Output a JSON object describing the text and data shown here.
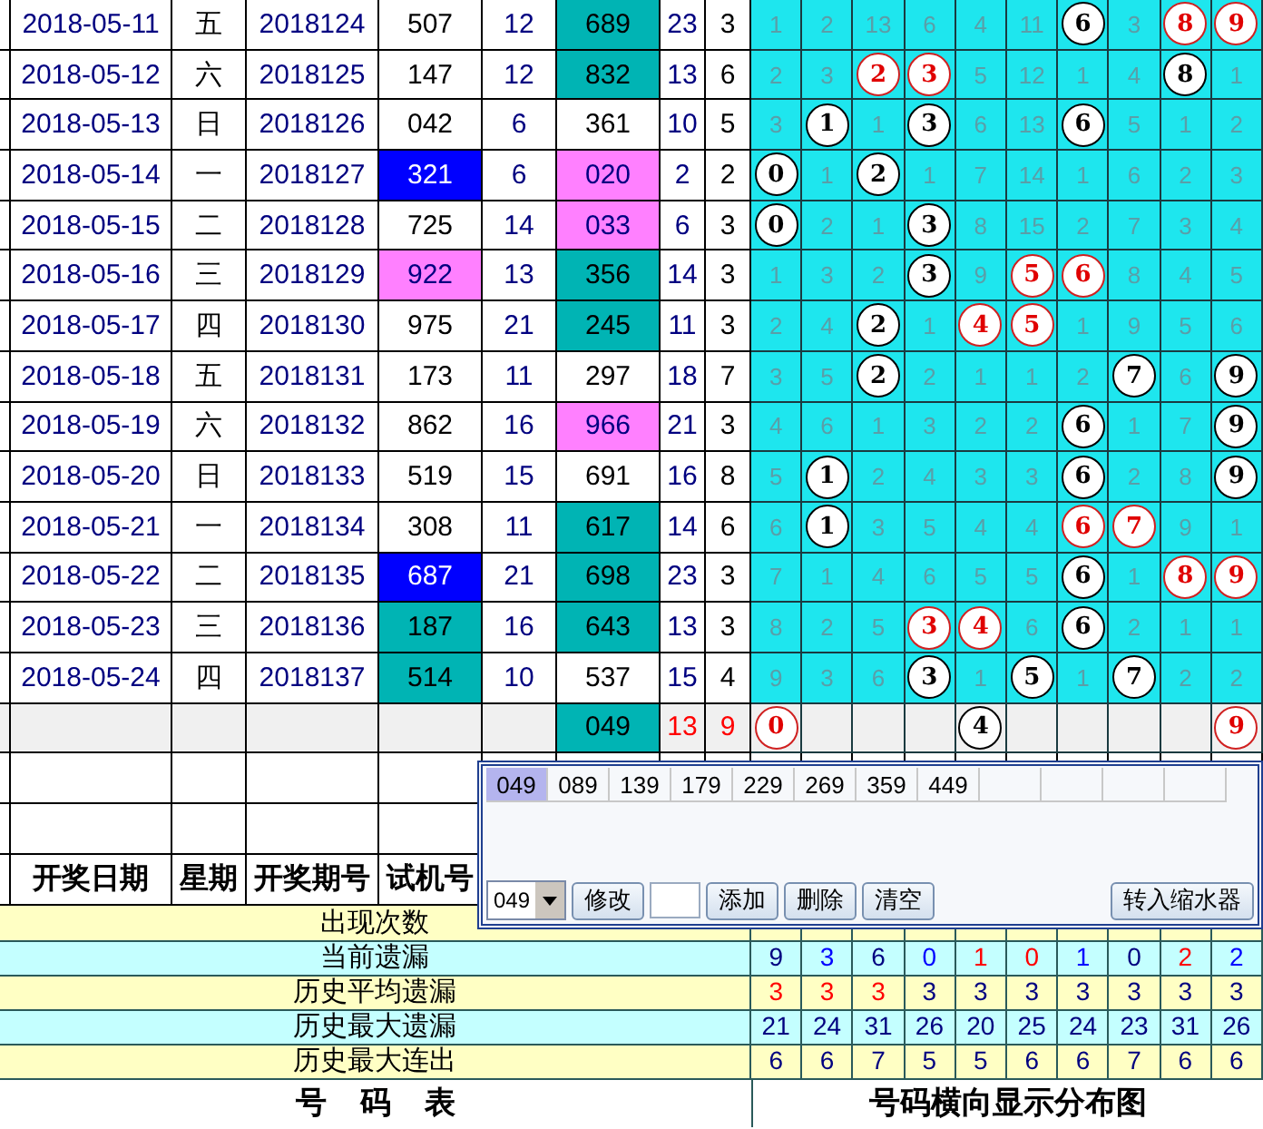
{
  "rows": [
    {
      "date": "2018-05-11",
      "weekday": "五",
      "period": "2018124",
      "trial": {
        "value": "507"
      },
      "sum": "12",
      "result": {
        "value": "689",
        "color": "#00b4b4"
      },
      "result_sum": "23",
      "span": "3",
      "cells": [
        {
          "kind": "plain",
          "value": "1"
        },
        {
          "kind": "plain",
          "value": "2"
        },
        {
          "kind": "plain",
          "value": "13"
        },
        {
          "kind": "plain",
          "value": "6"
        },
        {
          "kind": "plain",
          "value": "4"
        },
        {
          "kind": "plain",
          "value": "11"
        },
        {
          "kind": "ball",
          "value": "6",
          "red": false
        },
        {
          "kind": "plain",
          "value": "3"
        },
        {
          "kind": "ball",
          "value": "8",
          "red": true
        },
        {
          "kind": "ball",
          "value": "9",
          "red": true
        }
      ]
    },
    {
      "date": "2018-05-12",
      "weekday": "六",
      "period": "2018125",
      "trial": {
        "value": "147"
      },
      "sum": "12",
      "result": {
        "value": "832",
        "color": "#00b4b4"
      },
      "result_sum": "13",
      "span": "6",
      "cells": [
        {
          "kind": "plain",
          "value": "2"
        },
        {
          "kind": "plain",
          "value": "3"
        },
        {
          "kind": "ball",
          "value": "2",
          "red": true
        },
        {
          "kind": "ball",
          "value": "3",
          "red": true
        },
        {
          "kind": "plain",
          "value": "5"
        },
        {
          "kind": "plain",
          "value": "12"
        },
        {
          "kind": "plain",
          "value": "1"
        },
        {
          "kind": "plain",
          "value": "4"
        },
        {
          "kind": "ball",
          "value": "8",
          "red": false
        },
        {
          "kind": "plain",
          "value": "1"
        }
      ]
    },
    {
      "date": "2018-05-13",
      "weekday": "日",
      "period": "2018126",
      "trial": {
        "value": "042"
      },
      "sum": "6",
      "result": {
        "value": "361"
      },
      "result_sum": "10",
      "span": "5",
      "cells": [
        {
          "kind": "plain",
          "value": "3"
        },
        {
          "kind": "ball",
          "value": "1",
          "red": false
        },
        {
          "kind": "plain",
          "value": "1"
        },
        {
          "kind": "ball",
          "value": "3",
          "red": false
        },
        {
          "kind": "plain",
          "value": "6"
        },
        {
          "kind": "plain",
          "value": "13"
        },
        {
          "kind": "ball",
          "value": "6",
          "red": false
        },
        {
          "kind": "plain",
          "value": "5"
        },
        {
          "kind": "plain",
          "value": "1"
        },
        {
          "kind": "plain",
          "value": "2"
        }
      ]
    },
    {
      "date": "2018-05-14",
      "weekday": "一",
      "period": "2018127",
      "trial": {
        "value": "321",
        "color": "#0000ff"
      },
      "sum": "6",
      "result": {
        "value": "020",
        "color": "#ff80ff"
      },
      "result_sum": "2",
      "span": "2",
      "cells": [
        {
          "kind": "ball",
          "value": "0",
          "red": false
        },
        {
          "kind": "plain",
          "value": "1"
        },
        {
          "kind": "ball",
          "value": "2",
          "red": false
        },
        {
          "kind": "plain",
          "value": "1"
        },
        {
          "kind": "plain",
          "value": "7"
        },
        {
          "kind": "plain",
          "value": "14"
        },
        {
          "kind": "plain",
          "value": "1"
        },
        {
          "kind": "plain",
          "value": "6"
        },
        {
          "kind": "plain",
          "value": "2"
        },
        {
          "kind": "plain",
          "value": "3"
        }
      ]
    },
    {
      "date": "2018-05-15",
      "weekday": "二",
      "period": "2018128",
      "trial": {
        "value": "725"
      },
      "sum": "14",
      "result": {
        "value": "033",
        "color": "#ff80ff"
      },
      "result_sum": "6",
      "span": "3",
      "cells": [
        {
          "kind": "ball",
          "value": "0",
          "red": false
        },
        {
          "kind": "plain",
          "value": "2"
        },
        {
          "kind": "plain",
          "value": "1"
        },
        {
          "kind": "ball",
          "value": "3",
          "red": false
        },
        {
          "kind": "plain",
          "value": "8"
        },
        {
          "kind": "plain",
          "value": "15"
        },
        {
          "kind": "plain",
          "value": "2"
        },
        {
          "kind": "plain",
          "value": "7"
        },
        {
          "kind": "plain",
          "value": "3"
        },
        {
          "kind": "plain",
          "value": "4"
        }
      ]
    },
    {
      "date": "2018-05-16",
      "weekday": "三",
      "period": "2018129",
      "trial": {
        "value": "922",
        "color": "#ff80ff"
      },
      "sum": "13",
      "result": {
        "value": "356",
        "color": "#00b4b4"
      },
      "result_sum": "14",
      "span": "3",
      "cells": [
        {
          "kind": "plain",
          "value": "1"
        },
        {
          "kind": "plain",
          "value": "3"
        },
        {
          "kind": "plain",
          "value": "2"
        },
        {
          "kind": "ball",
          "value": "3",
          "red": false
        },
        {
          "kind": "plain",
          "value": "9"
        },
        {
          "kind": "ball",
          "value": "5",
          "red": true
        },
        {
          "kind": "ball",
          "value": "6",
          "red": true
        },
        {
          "kind": "plain",
          "value": "8"
        },
        {
          "kind": "plain",
          "value": "4"
        },
        {
          "kind": "plain",
          "value": "5"
        }
      ]
    },
    {
      "date": "2018-05-17",
      "weekday": "四",
      "period": "2018130",
      "trial": {
        "value": "975"
      },
      "sum": "21",
      "result": {
        "value": "245",
        "color": "#00b4b4"
      },
      "result_sum": "11",
      "span": "3",
      "cells": [
        {
          "kind": "plain",
          "value": "2"
        },
        {
          "kind": "plain",
          "value": "4"
        },
        {
          "kind": "ball",
          "value": "2",
          "red": false
        },
        {
          "kind": "plain",
          "value": "1"
        },
        {
          "kind": "ball",
          "value": "4",
          "red": true
        },
        {
          "kind": "ball",
          "value": "5",
          "red": true
        },
        {
          "kind": "plain",
          "value": "1"
        },
        {
          "kind": "plain",
          "value": "9"
        },
        {
          "kind": "plain",
          "value": "5"
        },
        {
          "kind": "plain",
          "value": "6"
        }
      ]
    },
    {
      "date": "2018-05-18",
      "weekday": "五",
      "period": "2018131",
      "trial": {
        "value": "173"
      },
      "sum": "11",
      "result": {
        "value": "297"
      },
      "result_sum": "18",
      "span": "7",
      "cells": [
        {
          "kind": "plain",
          "value": "3"
        },
        {
          "kind": "plain",
          "value": "5"
        },
        {
          "kind": "ball",
          "value": "2",
          "red": false
        },
        {
          "kind": "plain",
          "value": "2"
        },
        {
          "kind": "plain",
          "value": "1"
        },
        {
          "kind": "plain",
          "value": "1"
        },
        {
          "kind": "plain",
          "value": "2"
        },
        {
          "kind": "ball",
          "value": "7",
          "red": false
        },
        {
          "kind": "plain",
          "value": "6"
        },
        {
          "kind": "ball",
          "value": "9",
          "red": false
        }
      ]
    },
    {
      "date": "2018-05-19",
      "weekday": "六",
      "period": "2018132",
      "trial": {
        "value": "862"
      },
      "sum": "16",
      "result": {
        "value": "966",
        "color": "#ff80ff"
      },
      "result_sum": "21",
      "span": "3",
      "cells": [
        {
          "kind": "plain",
          "value": "4"
        },
        {
          "kind": "plain",
          "value": "6"
        },
        {
          "kind": "plain",
          "value": "1"
        },
        {
          "kind": "plain",
          "value": "3"
        },
        {
          "kind": "plain",
          "value": "2"
        },
        {
          "kind": "plain",
          "value": "2"
        },
        {
          "kind": "ball",
          "value": "6",
          "red": false
        },
        {
          "kind": "plain",
          "value": "1"
        },
        {
          "kind": "plain",
          "value": "7"
        },
        {
          "kind": "ball",
          "value": "9",
          "red": false
        }
      ]
    },
    {
      "date": "2018-05-20",
      "weekday": "日",
      "period": "2018133",
      "trial": {
        "value": "519"
      },
      "sum": "15",
      "result": {
        "value": "691"
      },
      "result_sum": "16",
      "span": "8",
      "cells": [
        {
          "kind": "plain",
          "value": "5"
        },
        {
          "kind": "ball",
          "value": "1",
          "red": false
        },
        {
          "kind": "plain",
          "value": "2"
        },
        {
          "kind": "plain",
          "value": "4"
        },
        {
          "kind": "plain",
          "value": "3"
        },
        {
          "kind": "plain",
          "value": "3"
        },
        {
          "kind": "ball",
          "value": "6",
          "red": false
        },
        {
          "kind": "plain",
          "value": "2"
        },
        {
          "kind": "plain",
          "value": "8"
        },
        {
          "kind": "ball",
          "value": "9",
          "red": false
        }
      ]
    },
    {
      "date": "2018-05-21",
      "weekday": "一",
      "period": "2018134",
      "trial": {
        "value": "308"
      },
      "sum": "11",
      "result": {
        "value": "617",
        "color": "#00b4b4"
      },
      "result_sum": "14",
      "span": "6",
      "cells": [
        {
          "kind": "plain",
          "value": "6"
        },
        {
          "kind": "ball",
          "value": "1",
          "red": false
        },
        {
          "kind": "plain",
          "value": "3"
        },
        {
          "kind": "plain",
          "value": "5"
        },
        {
          "kind": "plain",
          "value": "4"
        },
        {
          "kind": "plain",
          "value": "4"
        },
        {
          "kind": "ball",
          "value": "6",
          "red": true
        },
        {
          "kind": "ball",
          "value": "7",
          "red": true
        },
        {
          "kind": "plain",
          "value": "9"
        },
        {
          "kind": "plain",
          "value": "1"
        }
      ]
    },
    {
      "date": "2018-05-22",
      "weekday": "二",
      "period": "2018135",
      "trial": {
        "value": "687",
        "color": "#0000ff"
      },
      "sum": "21",
      "result": {
        "value": "698",
        "color": "#00b4b4"
      },
      "result_sum": "23",
      "span": "3",
      "cells": [
        {
          "kind": "plain",
          "value": "7"
        },
        {
          "kind": "plain",
          "value": "1"
        },
        {
          "kind": "plain",
          "value": "4"
        },
        {
          "kind": "plain",
          "value": "6"
        },
        {
          "kind": "plain",
          "value": "5"
        },
        {
          "kind": "plain",
          "value": "5"
        },
        {
          "kind": "ball",
          "value": "6",
          "red": false
        },
        {
          "kind": "plain",
          "value": "1"
        },
        {
          "kind": "ball",
          "value": "8",
          "red": true
        },
        {
          "kind": "ball",
          "value": "9",
          "red": true
        }
      ]
    },
    {
      "date": "2018-05-23",
      "weekday": "三",
      "period": "2018136",
      "trial": {
        "value": "187",
        "color": "#00b4b4"
      },
      "sum": "16",
      "result": {
        "value": "643",
        "color": "#00b4b4"
      },
      "result_sum": "13",
      "span": "3",
      "cells": [
        {
          "kind": "plain",
          "value": "8"
        },
        {
          "kind": "plain",
          "value": "2"
        },
        {
          "kind": "plain",
          "value": "5"
        },
        {
          "kind": "ball",
          "value": "3",
          "red": true
        },
        {
          "kind": "ball",
          "value": "4",
          "red": true
        },
        {
          "kind": "plain",
          "value": "6"
        },
        {
          "kind": "ball",
          "value": "6",
          "red": false
        },
        {
          "kind": "plain",
          "value": "2"
        },
        {
          "kind": "plain",
          "value": "1"
        },
        {
          "kind": "plain",
          "value": "1"
        }
      ]
    },
    {
      "date": "2018-05-24",
      "weekday": "四",
      "period": "2018137",
      "trial": {
        "value": "514",
        "color": "#00b4b4"
      },
      "sum": "10",
      "result": {
        "value": "537"
      },
      "result_sum": "15",
      "span": "4",
      "cells": [
        {
          "kind": "plain",
          "value": "9"
        },
        {
          "kind": "plain",
          "value": "3"
        },
        {
          "kind": "plain",
          "value": "6"
        },
        {
          "kind": "ball",
          "value": "3",
          "red": false
        },
        {
          "kind": "plain",
          "value": "1"
        },
        {
          "kind": "ball",
          "value": "5",
          "red": false
        },
        {
          "kind": "plain",
          "value": "1"
        },
        {
          "kind": "ball",
          "value": "7",
          "red": false
        },
        {
          "kind": "plain",
          "value": "2"
        },
        {
          "kind": "plain",
          "value": "2"
        }
      ]
    }
  ],
  "pending_row": {
    "result": {
      "value": "049",
      "color": "#00b4b4"
    },
    "result_sum": "13",
    "span": "9",
    "cells": [
      {
        "kind": "ball",
        "value": "0",
        "red": true
      },
      {
        "kind": "empty"
      },
      {
        "kind": "empty"
      },
      {
        "kind": "empty"
      },
      {
        "kind": "ball",
        "value": "4",
        "red": false
      },
      {
        "kind": "empty"
      },
      {
        "kind": "empty"
      },
      {
        "kind": "empty"
      },
      {
        "kind": "empty"
      },
      {
        "kind": "ball",
        "value": "9",
        "red": true
      }
    ]
  },
  "header": [
    "开奖日期",
    "星期",
    "开奖期号",
    "试机号"
  ],
  "stats": [
    {
      "label": "出现次数"
    },
    {
      "label": "当前遗漏",
      "values": [
        {
          "value": "9",
          "color": "#000080"
        },
        {
          "value": "3",
          "color": "#0000ff"
        },
        {
          "value": "6",
          "color": "#000080"
        },
        {
          "value": "0",
          "color": "#0000ff"
        },
        {
          "value": "1",
          "color": "#ff0000"
        },
        {
          "value": "0",
          "color": "#ff0000"
        },
        {
          "value": "1",
          "color": "#0000ff"
        },
        {
          "value": "0",
          "color": "#000080"
        },
        {
          "value": "2",
          "color": "#ff0000"
        },
        {
          "value": "2",
          "color": "#0000ff"
        }
      ]
    },
    {
      "label": "历史平均遗漏",
      "values": [
        {
          "value": "3",
          "color": "#ff0000"
        },
        {
          "value": "3",
          "color": "#ff0000"
        },
        {
          "value": "3",
          "color": "#ff0000"
        },
        {
          "value": "3",
          "color": "#000080"
        },
        {
          "value": "3",
          "color": "#000080"
        },
        {
          "value": "3",
          "color": "#000080"
        },
        {
          "value": "3",
          "color": "#000080"
        },
        {
          "value": "3",
          "color": "#000080"
        },
        {
          "value": "3",
          "color": "#000080"
        },
        {
          "value": "3",
          "color": "#000080"
        }
      ]
    },
    {
      "label": "历史最大遗漏",
      "values": [
        {
          "value": "21",
          "color": "#000080"
        },
        {
          "value": "24",
          "color": "#000080"
        },
        {
          "value": "31",
          "color": "#000080"
        },
        {
          "value": "26",
          "color": "#000080"
        },
        {
          "value": "20",
          "color": "#000080"
        },
        {
          "value": "25",
          "color": "#000080"
        },
        {
          "value": "24",
          "color": "#000080"
        },
        {
          "value": "23",
          "color": "#000080"
        },
        {
          "value": "31",
          "color": "#000080"
        },
        {
          "value": "26",
          "color": "#000080"
        }
      ]
    },
    {
      "label": "历史最大连出",
      "values": [
        {
          "value": "6",
          "color": "#000080"
        },
        {
          "value": "6",
          "color": "#000080"
        },
        {
          "value": "7",
          "color": "#000080"
        },
        {
          "value": "5",
          "color": "#000080"
        },
        {
          "value": "5",
          "color": "#000080"
        },
        {
          "value": "6",
          "color": "#000080"
        },
        {
          "value": "6",
          "color": "#000080"
        },
        {
          "value": "7",
          "color": "#000080"
        },
        {
          "value": "6",
          "color": "#000080"
        },
        {
          "value": "6",
          "color": "#000080"
        }
      ]
    }
  ],
  "footer": {
    "left": "号 码 表",
    "right": "号码横向显示分布图"
  },
  "popup": {
    "numbers": [
      {
        "text": "049",
        "selected": true
      },
      {
        "text": "089",
        "selected": false
      },
      {
        "text": "139",
        "selected": false
      },
      {
        "text": "179",
        "selected": false
      },
      {
        "text": "229",
        "selected": false
      },
      {
        "text": "269",
        "selected": false
      },
      {
        "text": "359",
        "selected": false
      },
      {
        "text": "449",
        "selected": false
      }
    ],
    "controls": [
      {
        "kind": "select",
        "value": "049"
      },
      {
        "kind": "button",
        "label": "修改"
      },
      {
        "kind": "input"
      },
      {
        "kind": "button",
        "label": "添加"
      },
      {
        "kind": "button",
        "label": "删除"
      },
      {
        "kind": "button",
        "label": "清空"
      },
      {
        "kind": "button",
        "label": "转入缩水器"
      }
    ]
  }
}
